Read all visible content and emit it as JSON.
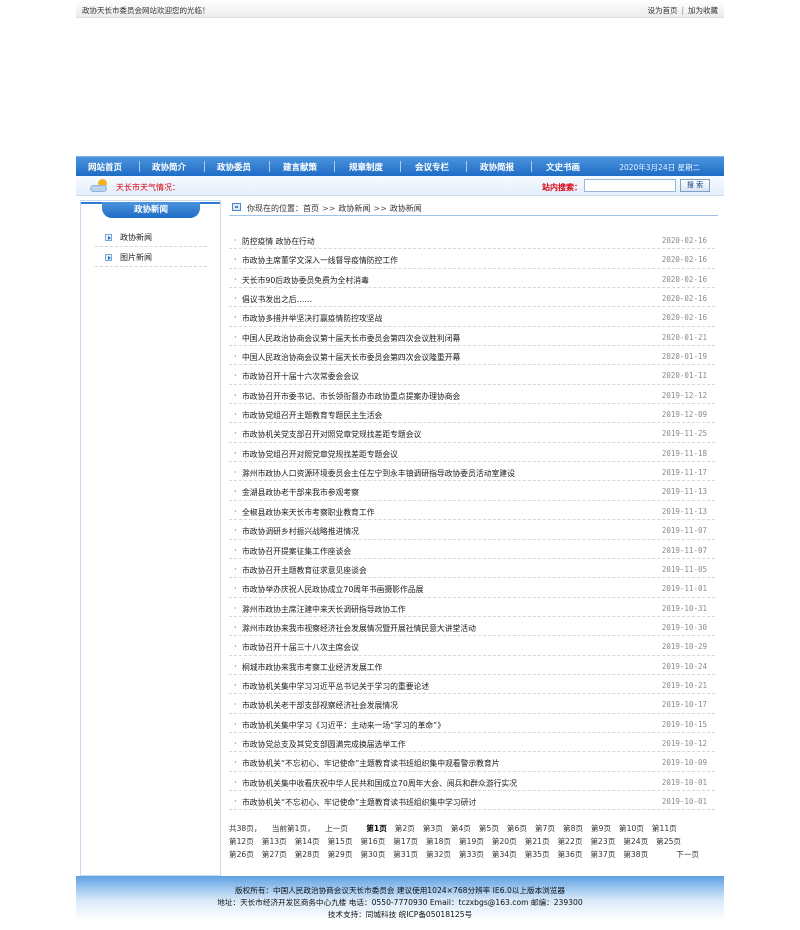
{
  "topbar": {
    "welcome": "政协天长市委员会网站欢迎您的光临！",
    "set_home": "设为首页",
    "divider": "|",
    "add_favorite": "加为收藏"
  },
  "nav": {
    "items": [
      "网站首页",
      "政协简介",
      "政协委员",
      "建言献策",
      "规章制度",
      "会议专栏",
      "政协简报",
      "文史书画"
    ],
    "date": "2020年3月24日 星期二"
  },
  "weather": {
    "label": "天长市天气情况："
  },
  "search": {
    "label": "站内搜索：",
    "value": "",
    "button": "搜 索"
  },
  "sidebar": {
    "title": "政协新闻",
    "items": [
      "政协新闻",
      "图片新闻"
    ]
  },
  "breadcrumb": {
    "prefix": "你现在的位置：",
    "home": "首页",
    "sep": ">>",
    "level1": "政协新闻",
    "level2": "政协新闻"
  },
  "news": [
    {
      "title": "防控疫情 政协在行动",
      "date": "2020-02-16"
    },
    {
      "title": "市政协主席董学文深入一线督导疫情防控工作",
      "date": "2020-02-16"
    },
    {
      "title": "天长市90后政协委员免费为全村消毒",
      "date": "2020-02-16"
    },
    {
      "title": "倡议书发出之后……",
      "date": "2020-02-16"
    },
    {
      "title": "市政协多措并举坚决打赢疫情防控攻坚战",
      "date": "2020-02-16"
    },
    {
      "title": "中国人民政治协商会议第十届天长市委员会第四次会议胜利闭幕",
      "date": "2020-01-21"
    },
    {
      "title": "中国人民政治协商会议第十届天长市委员会第四次会议隆重开幕",
      "date": "2020-01-19"
    },
    {
      "title": "市政协召开十届十六次常委会会议",
      "date": "2020-01-11"
    },
    {
      "title": "市政协召开市委书记、市长领衔督办市政协重点提案办理协商会",
      "date": "2019-12-12"
    },
    {
      "title": "市政协党组召开主题教育专题民主生活会",
      "date": "2019-12-09"
    },
    {
      "title": "市政协机关党支部召开对照党章党规找差距专题会议",
      "date": "2019-11-25"
    },
    {
      "title": "市政协党组召开对照党章党规找差距专题会议",
      "date": "2019-11-18"
    },
    {
      "title": "滁州市政协人口资源环境委员会主任左宁到永丰镇调研指导政协委员活动室建设",
      "date": "2019-11-17"
    },
    {
      "title": "金湖县政协老干部来我市参观考察",
      "date": "2019-11-13"
    },
    {
      "title": "全椒县政协来天长市考察职业教育工作",
      "date": "2019-11-13"
    },
    {
      "title": "市政协调研乡村振兴战略推进情况",
      "date": "2019-11-07"
    },
    {
      "title": "市政协召开提案征集工作座谈会",
      "date": "2019-11-07"
    },
    {
      "title": "市政协召开主题教育征求意见座谈会",
      "date": "2019-11-05"
    },
    {
      "title": "市政协举办庆祝人民政协成立70周年书画摄影作品展",
      "date": "2019-11-01"
    },
    {
      "title": "滁州市政协主席汪建中来天长调研指导政协工作",
      "date": "2019-10-31"
    },
    {
      "title": "滁州市政协来我市视察经济社会发展情况暨开展社情民意大讲堂活动",
      "date": "2019-10-30"
    },
    {
      "title": "市政协召开十届三十八次主席会议",
      "date": "2019-10-29"
    },
    {
      "title": "桐城市政协来我市考察工业经济发展工作",
      "date": "2019-10-24"
    },
    {
      "title": "市政协机关集中学习习近平总书记关于学习的重要论述",
      "date": "2019-10-21"
    },
    {
      "title": "市政协机关老干部支部视察经济社会发展情况",
      "date": "2019-10-17"
    },
    {
      "title": "市政协机关集中学习《习近平：主动来一场“学习的革命”》",
      "date": "2019-10-15"
    },
    {
      "title": "市政协党总支及其党支部圆满完成换届选举工作",
      "date": "2019-10-12"
    },
    {
      "title": "市政协机关“不忘初心、牢记使命”主题教育读书班组织集中观看警示教育片",
      "date": "2019-10-09"
    },
    {
      "title": "市政协机关集中收看庆祝中华人民共和国成立70周年大会、阅兵和群众游行实况",
      "date": "2019-10-01"
    },
    {
      "title": "市政协机关“不忘初心、牢记使命”主题教育读书班组织集中学习研讨",
      "date": "2019-10-01"
    }
  ],
  "pager": {
    "total": "共38页，",
    "current": "当前第1页，",
    "prev": "上一页",
    "next": "下一页",
    "pages": [
      "第1页",
      "第2页",
      "第3页",
      "第4页",
      "第5页",
      "第6页",
      "第7页",
      "第8页",
      "第9页",
      "第10页",
      "第11页",
      "第12页",
      "第13页",
      "第14页",
      "第15页",
      "第16页",
      "第17页",
      "第18页",
      "第19页",
      "第20页",
      "第21页",
      "第22页",
      "第23页",
      "第24页",
      "第25页",
      "第26页",
      "第27页",
      "第28页",
      "第29页",
      "第30页",
      "第31页",
      "第32页",
      "第33页",
      "第34页",
      "第35页",
      "第36页",
      "第37页",
      "第38页"
    ]
  },
  "footer": {
    "line1": "版权所有：中国人民政治协商会议天长市委员会 建议使用1024×768分辨率 IE6.0以上版本浏览器",
    "line2": "地址：天长市经济开发区商务中心九楼  电话：0550-7770930  Email：tczxbgs@163.com  邮编：239300",
    "line3": "技术支持：同城科技 皖ICP备05018125号"
  }
}
